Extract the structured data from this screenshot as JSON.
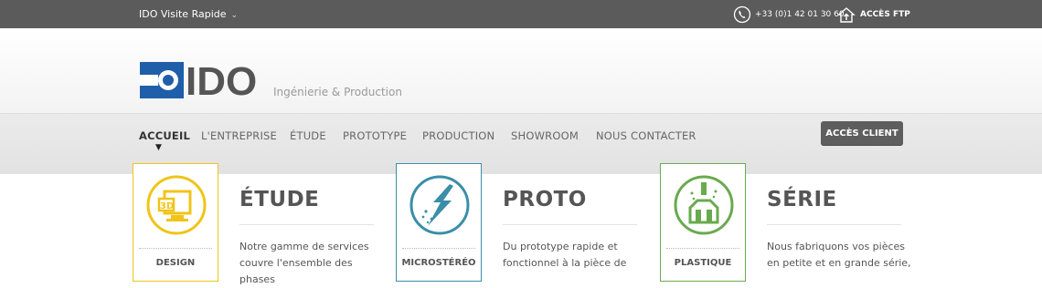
{
  "topbar": {
    "quick_label": "IDO Visite Rapide",
    "phone": "+33 (0)1 42 01 30 60",
    "ftp_label": "ACCÈS FTP"
  },
  "header": {
    "logo_text": "IDO",
    "tagline": "Ingénierie & Production"
  },
  "nav": {
    "items": [
      "ACCUEIL",
      "L'ENTREPRISE",
      "ÉTUDE",
      "PROTOTYPE",
      "PRODUCTION",
      "SHOWROOM",
      "NOUS CONTACTER"
    ],
    "active": "ACCUEIL",
    "client_button": "ACCÈS CLIENT"
  },
  "features": [
    {
      "badge": "DESIGN",
      "title": "ÉTUDE",
      "text_lines": [
        "Notre gamme de services",
        "couvre l'ensemble des phases"
      ],
      "color": "#f0c419",
      "icon": "3d-monitor-icon"
    },
    {
      "badge": "MICROSTÉRÉO",
      "title": "PROTO",
      "text_lines": [
        "Du prototype rapide et",
        "fonctionnel à la pièce de"
      ],
      "color": "#3a8ea8",
      "icon": "lightning-icon"
    },
    {
      "badge": "PLASTIQUE",
      "title": "SÉRIE",
      "text_lines": [
        "Nous fabriquons vos pièces",
        "en petite et en grande série,"
      ],
      "color": "#6aaa4e",
      "icon": "injection-mold-icon"
    }
  ],
  "colors": {
    "topbar": "#5b5b5b",
    "logo_blue": "#1f5ea8",
    "logo_gray": "#555555"
  }
}
